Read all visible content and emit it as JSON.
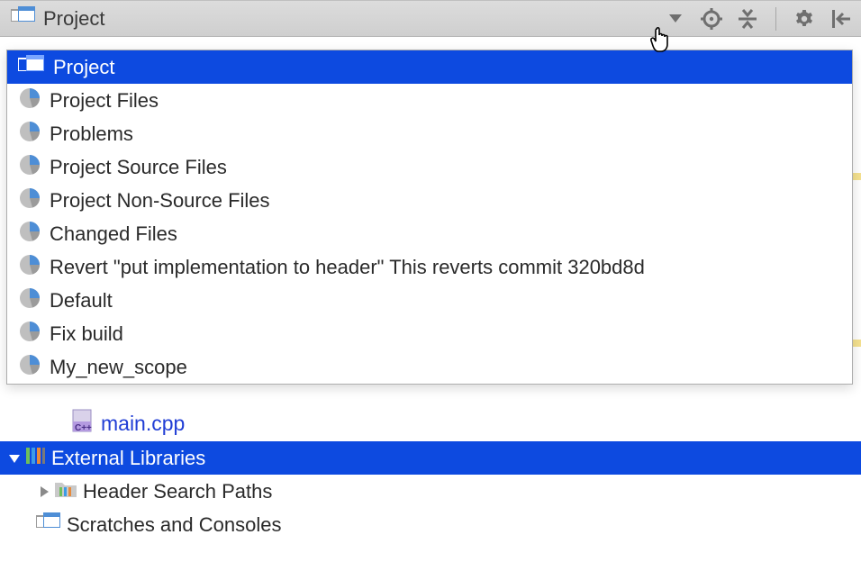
{
  "header": {
    "title": "Project"
  },
  "dropdown": {
    "items": [
      {
        "label": "Project",
        "icon": "file-rects",
        "selected": true
      },
      {
        "label": "Project Files",
        "icon": "pie"
      },
      {
        "label": "Problems",
        "icon": "pie"
      },
      {
        "label": "Project Source Files",
        "icon": "pie"
      },
      {
        "label": "Project Non-Source Files",
        "icon": "pie"
      },
      {
        "label": "Changed Files",
        "icon": "pie"
      },
      {
        "label": "Revert \"put implementation to header\" This reverts commit 320bd8d",
        "icon": "pie"
      },
      {
        "label": "Default",
        "icon": "pie"
      },
      {
        "label": "Fix build",
        "icon": "pie"
      },
      {
        "label": "My_new_scope",
        "icon": "pie"
      }
    ]
  },
  "tree": {
    "file": "main.cpp",
    "external": "External Libraries",
    "header_paths": "Header Search Paths",
    "scratches": "Scratches and Consoles"
  }
}
